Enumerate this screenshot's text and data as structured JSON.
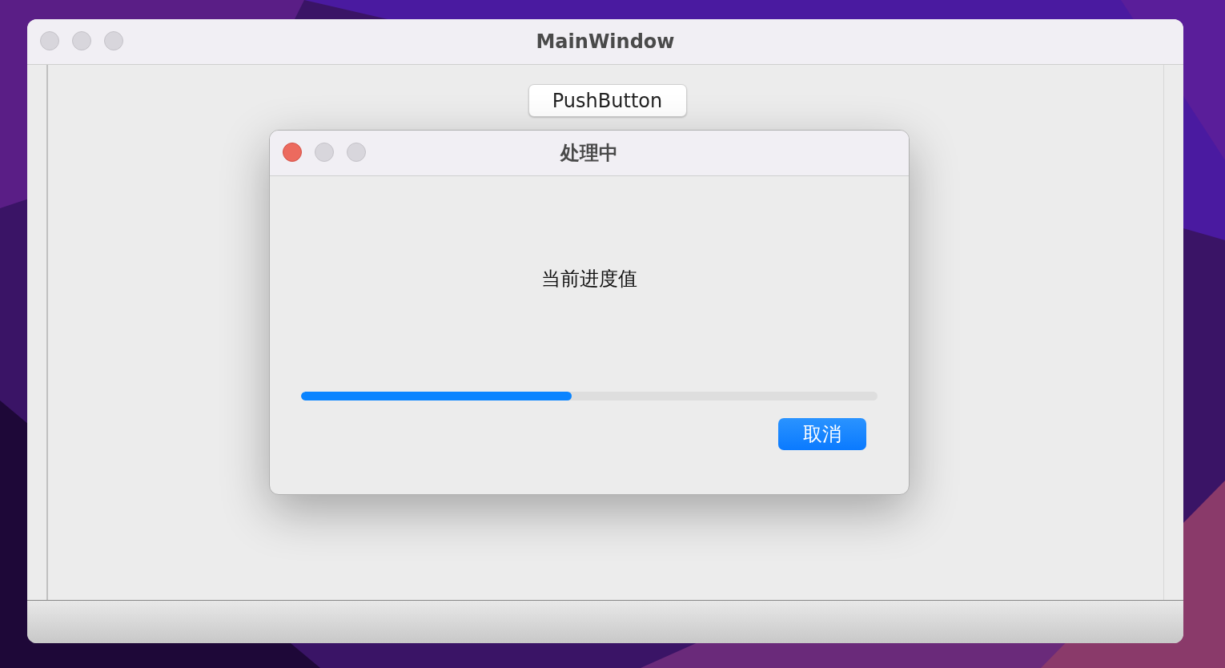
{
  "main_window": {
    "title": "MainWindow",
    "active": false,
    "push_button": "PushButton"
  },
  "dialog": {
    "title": "处理中",
    "active": true,
    "label": "当前进度值",
    "progress": {
      "level": 0.47
    },
    "cancel_button": "取消"
  }
}
